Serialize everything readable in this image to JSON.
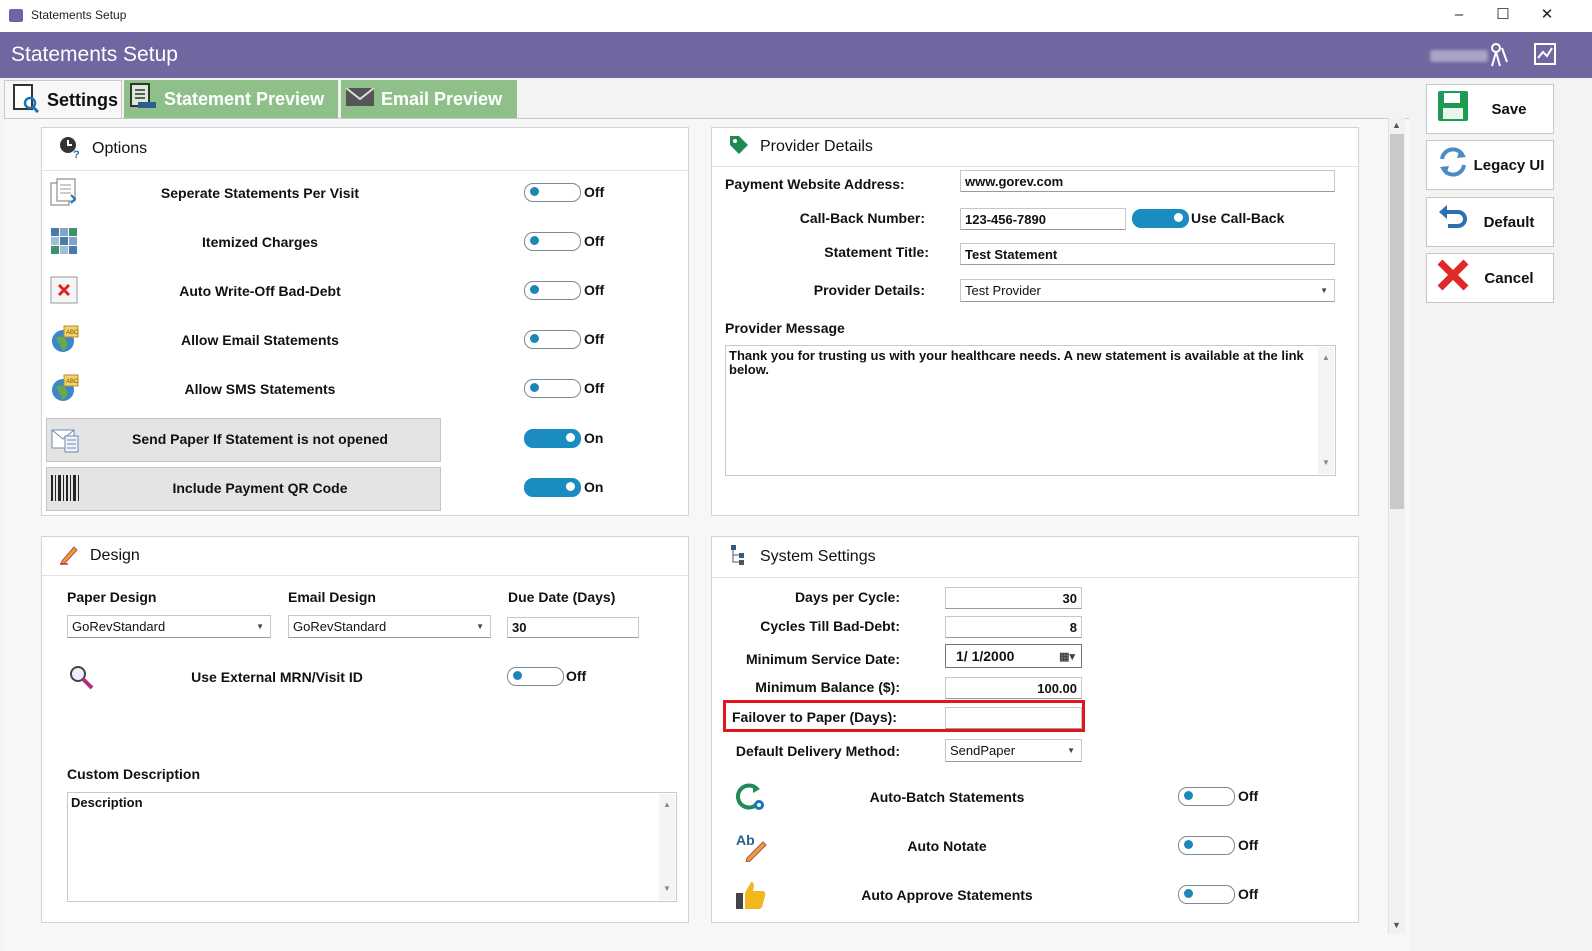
{
  "window": {
    "title": "Statements Setup",
    "minimize_icon": "minimize-icon",
    "maximize_icon": "maximize-icon",
    "close_icon": "close-icon"
  },
  "header": {
    "title": "Statements Setup"
  },
  "tabs": [
    {
      "label": "Settings",
      "icon": "settings-icon"
    },
    {
      "label": "Statement Preview",
      "icon": "statement-preview-icon"
    },
    {
      "label": "Email Preview",
      "icon": "email-icon"
    }
  ],
  "options": {
    "title": "Options",
    "items": [
      {
        "label": "Seperate Statements Per Visit",
        "state": "Off"
      },
      {
        "label": "Itemized Charges",
        "state": "Off"
      },
      {
        "label": "Auto Write-Off Bad-Debt",
        "state": "Off"
      },
      {
        "label": "Allow Email Statements",
        "state": "Off"
      },
      {
        "label": "Allow SMS Statements",
        "state": "Off"
      },
      {
        "label": "Send Paper If Statement is not opened",
        "state": "On"
      },
      {
        "label": "Include Payment QR Code",
        "state": "On"
      }
    ]
  },
  "provider": {
    "title": "Provider Details",
    "website_label": "Payment Website Address:",
    "website_value": "www.gorev.com",
    "callback_label": "Call-Back Number:",
    "callback_value": "123-456-7890",
    "use_callback_label": "Use Call-Back",
    "statement_title_label": "Statement Title:",
    "statement_title_value": "Test Statement",
    "provider_details_label": "Provider Details:",
    "provider_details_value": "Test Provider",
    "message_label": "Provider Message",
    "message_value": "Thank you for trusting us with your healthcare needs.  A new statement is available at the link below."
  },
  "design": {
    "title": "Design",
    "paper_label": "Paper Design",
    "paper_value": "GoRevStandard",
    "email_label": "Email Design",
    "email_value": "GoRevStandard",
    "due_label": "Due Date (Days)",
    "due_value": "30",
    "mrn_label": "Use External MRN/Visit ID",
    "mrn_state": "Off",
    "custom_label": "Custom Description",
    "custom_value": "Description"
  },
  "system": {
    "title": "System Settings",
    "days_label": "Days per Cycle:",
    "days_value": "30",
    "cycles_label": "Cycles Till Bad-Debt:",
    "cycles_value": "8",
    "min_date_label": "Minimum Service Date:",
    "min_date_value": "1/  1/2000",
    "min_balance_label": "Minimum Balance ($):",
    "min_balance_value": "100.00",
    "failover_label": "Failover to Paper (Days):",
    "failover_value": "",
    "delivery_label": "Default Delivery Method:",
    "delivery_value": "SendPaper",
    "toggles": [
      {
        "label": "Auto-Batch Statements",
        "state": "Off"
      },
      {
        "label": "Auto Notate",
        "state": "Off"
      },
      {
        "label": "Auto Approve Statements",
        "state": "Off"
      }
    ]
  },
  "actions": {
    "save": "Save",
    "legacy": "Legacy UI",
    "default": "Default",
    "cancel": "Cancel"
  },
  "colors": {
    "header_bg": "#6f679f",
    "tab_green": "#8fc08a",
    "toggle_on": "#1b8cbf",
    "highlight_red": "#e0161c"
  }
}
